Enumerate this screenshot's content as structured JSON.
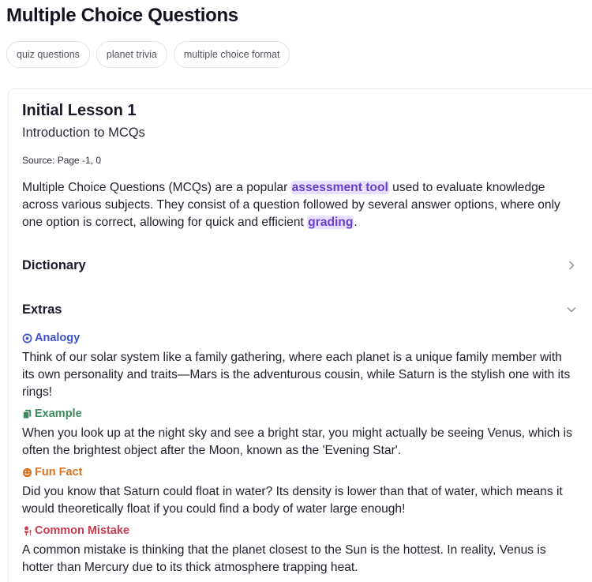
{
  "page": {
    "title": "Multiple Choice Questions"
  },
  "tags": [
    "quiz questions",
    "planet trivia",
    "multiple choice format"
  ],
  "lesson": {
    "title": "Initial Lesson 1",
    "subtitle": "Introduction to MCQs",
    "source": "Source: Page -1, 0",
    "body": {
      "part1": "Multiple Choice Questions (MCQs) are a popular ",
      "highlight1": "assessment tool",
      "part2": " used to evaluate knowledge across various subjects. They consist of a question followed by several answer options, where only one option is correct, allowing for quick and efficient ",
      "highlight2": "grading",
      "part3": "."
    }
  },
  "sections": {
    "dictionary": {
      "label": "Dictionary",
      "icon": "chevron-right-icon"
    },
    "extras": {
      "label": "Extras",
      "icon": "chevron-down-icon"
    }
  },
  "extras": {
    "analogy": {
      "label": "Analogy",
      "icon": "target-icon",
      "color": "#3d52c8",
      "text": "Think of our solar system like a family gathering, where each planet is a unique family member with its own personality and traits—Mars is the adventurous cousin, while Saturn is the stylish one with its rings!"
    },
    "example": {
      "label": "Example",
      "icon": "copy-icon",
      "color": "#3e8a5c",
      "text": "When you look up at the night sky and see a bright star, you might actually be seeing Venus, which is often the brightest object after the Moon, known as the 'Evening Star'."
    },
    "fun_fact": {
      "label": "Fun Fact",
      "icon": "smile-icon",
      "color": "#d8741e",
      "text": "Did you know that Saturn could float in water? Its density is lower than that of water, which means it would theoretically float if you could find a body of water large enough!"
    },
    "common_mistake": {
      "label": "Common Mistake",
      "icon": "warning-person-icon",
      "color": "#cc3a4f",
      "text": "A common mistake is thinking that the planet closest to the Sun is the hottest. In reality, Venus is hotter than Mercury due to its thick atmosphere trapping heat."
    }
  }
}
